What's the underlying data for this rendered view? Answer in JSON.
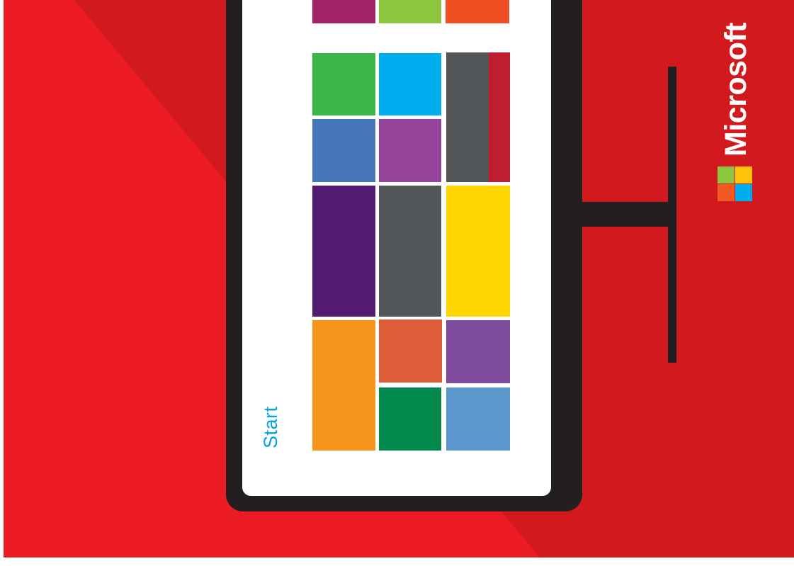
{
  "brand": {
    "name": "Microsoft",
    "text_color": "#ffffff",
    "logo_colors": [
      "#8cc63f",
      "#fec20b",
      "#f15a22",
      "#00adef"
    ]
  },
  "screen": {
    "start_label": "Start",
    "start_color": "#00a4e4"
  },
  "colors": {
    "background_light": "#ed1c24",
    "background_dark": "#d2191d",
    "device_frame": "#231f20",
    "screen": "#ffffff"
  },
  "tiles": [
    {
      "name": "tile-top-magenta",
      "color": "#a32166"
    },
    {
      "name": "tile-top-lime",
      "color": "#8cc63f"
    },
    {
      "name": "tile-top-orange",
      "color": "#f04e23"
    },
    {
      "name": "tile-green",
      "color": "#39b54a"
    },
    {
      "name": "tile-sky-blue",
      "color": "#00adef"
    },
    {
      "name": "tile-dark-gray-tall",
      "color": "#54575a"
    },
    {
      "name": "tile-red-strip",
      "color": "#be1e2d"
    },
    {
      "name": "tile-steel-blue",
      "color": "#4777bb"
    },
    {
      "name": "tile-purple",
      "color": "#93449a"
    },
    {
      "name": "tile-deep-purple",
      "color": "#531c72"
    },
    {
      "name": "tile-charcoal",
      "color": "#54575a"
    },
    {
      "name": "tile-yellow",
      "color": "#ffd600"
    },
    {
      "name": "tile-orange",
      "color": "#f7941e"
    },
    {
      "name": "tile-burnt-orange",
      "color": "#de5d38"
    },
    {
      "name": "tile-violet",
      "color": "#7e4b9d"
    },
    {
      "name": "tile-dark-green",
      "color": "#00894a"
    },
    {
      "name": "tile-light-blue",
      "color": "#5b96cd"
    }
  ]
}
